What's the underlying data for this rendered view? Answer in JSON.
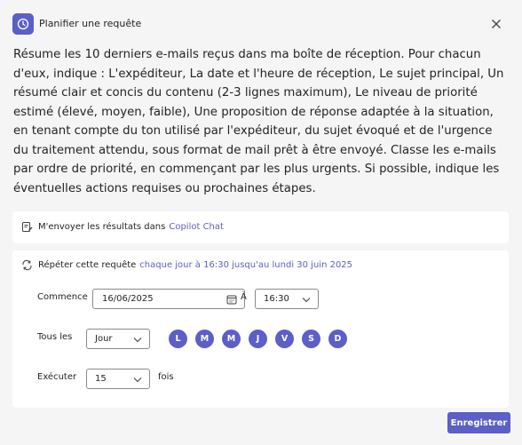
{
  "header": {
    "title": "Planifier une requête",
    "icon": "clock-icon",
    "close_icon": "close-icon"
  },
  "prompt": "Résume les 10 derniers e-mails reçus dans ma boîte de réception. Pour chacun d'eux, indique : L'expéditeur, La date et l'heure de réception, Le sujet principal, Un résumé clair et concis du contenu (2-3 lignes maximum), Le niveau de priorité estimé (élevé, moyen, faible), Une proposition de réponse adaptée à la situation, en tenant compte du ton utilisé par l'expéditeur, du sujet évoqué et de l'urgence du traitement attendu, sous format de mail prêt à être envoyé. Classe les e-mails par ordre de priorité, en commençant par les plus urgents. Si possible, indique les éventuelles actions requises ou prochaines étapes.",
  "send_results": {
    "label": "M'envoyer les résultats dans",
    "link": "Copilot Chat",
    "icon": "note-edit-icon"
  },
  "repeat": {
    "label": "Répéter cette requête",
    "link": "chaque jour à 16:30 jusqu'au lundi 30 juin 2025",
    "icon": "repeat-icon"
  },
  "schedule": {
    "start_label": "Commence",
    "start_date": "16/06/2025",
    "at_label": "À",
    "time": "16:30",
    "every_label": "Tous les",
    "frequency": "Jour",
    "days": [
      "L",
      "M",
      "M",
      "J",
      "V",
      "S",
      "D"
    ],
    "run_label": "Exécuter",
    "count": "15",
    "times_label": "fois"
  },
  "save_label": "Enregistrer",
  "colors": {
    "accent": "#5b5fc7",
    "background": "#f5f5f5",
    "card": "#ffffff"
  }
}
